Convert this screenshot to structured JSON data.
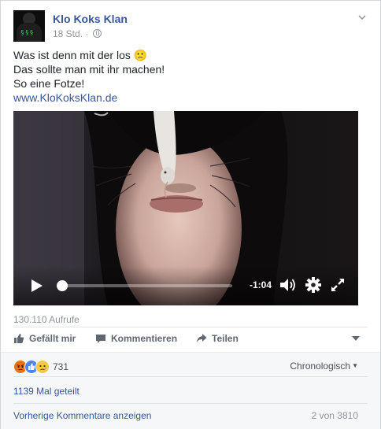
{
  "post": {
    "page_name": "Klo Koks Klan",
    "time": "18 Std.",
    "separator": "·",
    "lines": [
      "Was ist denn mit der los 🙁",
      "Das sollte man mit ihr machen!",
      "So eine Fotze!"
    ],
    "link": "www.KloKoksKlan.de",
    "avatar_mark": "§§§"
  },
  "video": {
    "time_remaining": "-1:04",
    "progress": 0.02,
    "icons": [
      "play-icon",
      "volume-icon",
      "gear-icon",
      "fullscreen-icon"
    ]
  },
  "stats": {
    "views": "130.110 Aufrufe"
  },
  "actions": {
    "like": "Gefällt mir",
    "comment": "Kommentieren",
    "share": "Teilen"
  },
  "feedback": {
    "reaction_count": "731",
    "reactions": [
      "angry",
      "like",
      "sad"
    ],
    "sort_label": "Chronologisch",
    "shares": "1139 Mal geteilt",
    "prev_comments": "Vorherige Kommentare anzeigen",
    "comment_count": "2 von 3810"
  },
  "colors": {
    "link": "#365899",
    "meta": "#90949c",
    "accent_like": "#4e86f0",
    "accent_angry": "#e9710f",
    "accent_sad": "#f7c844"
  }
}
